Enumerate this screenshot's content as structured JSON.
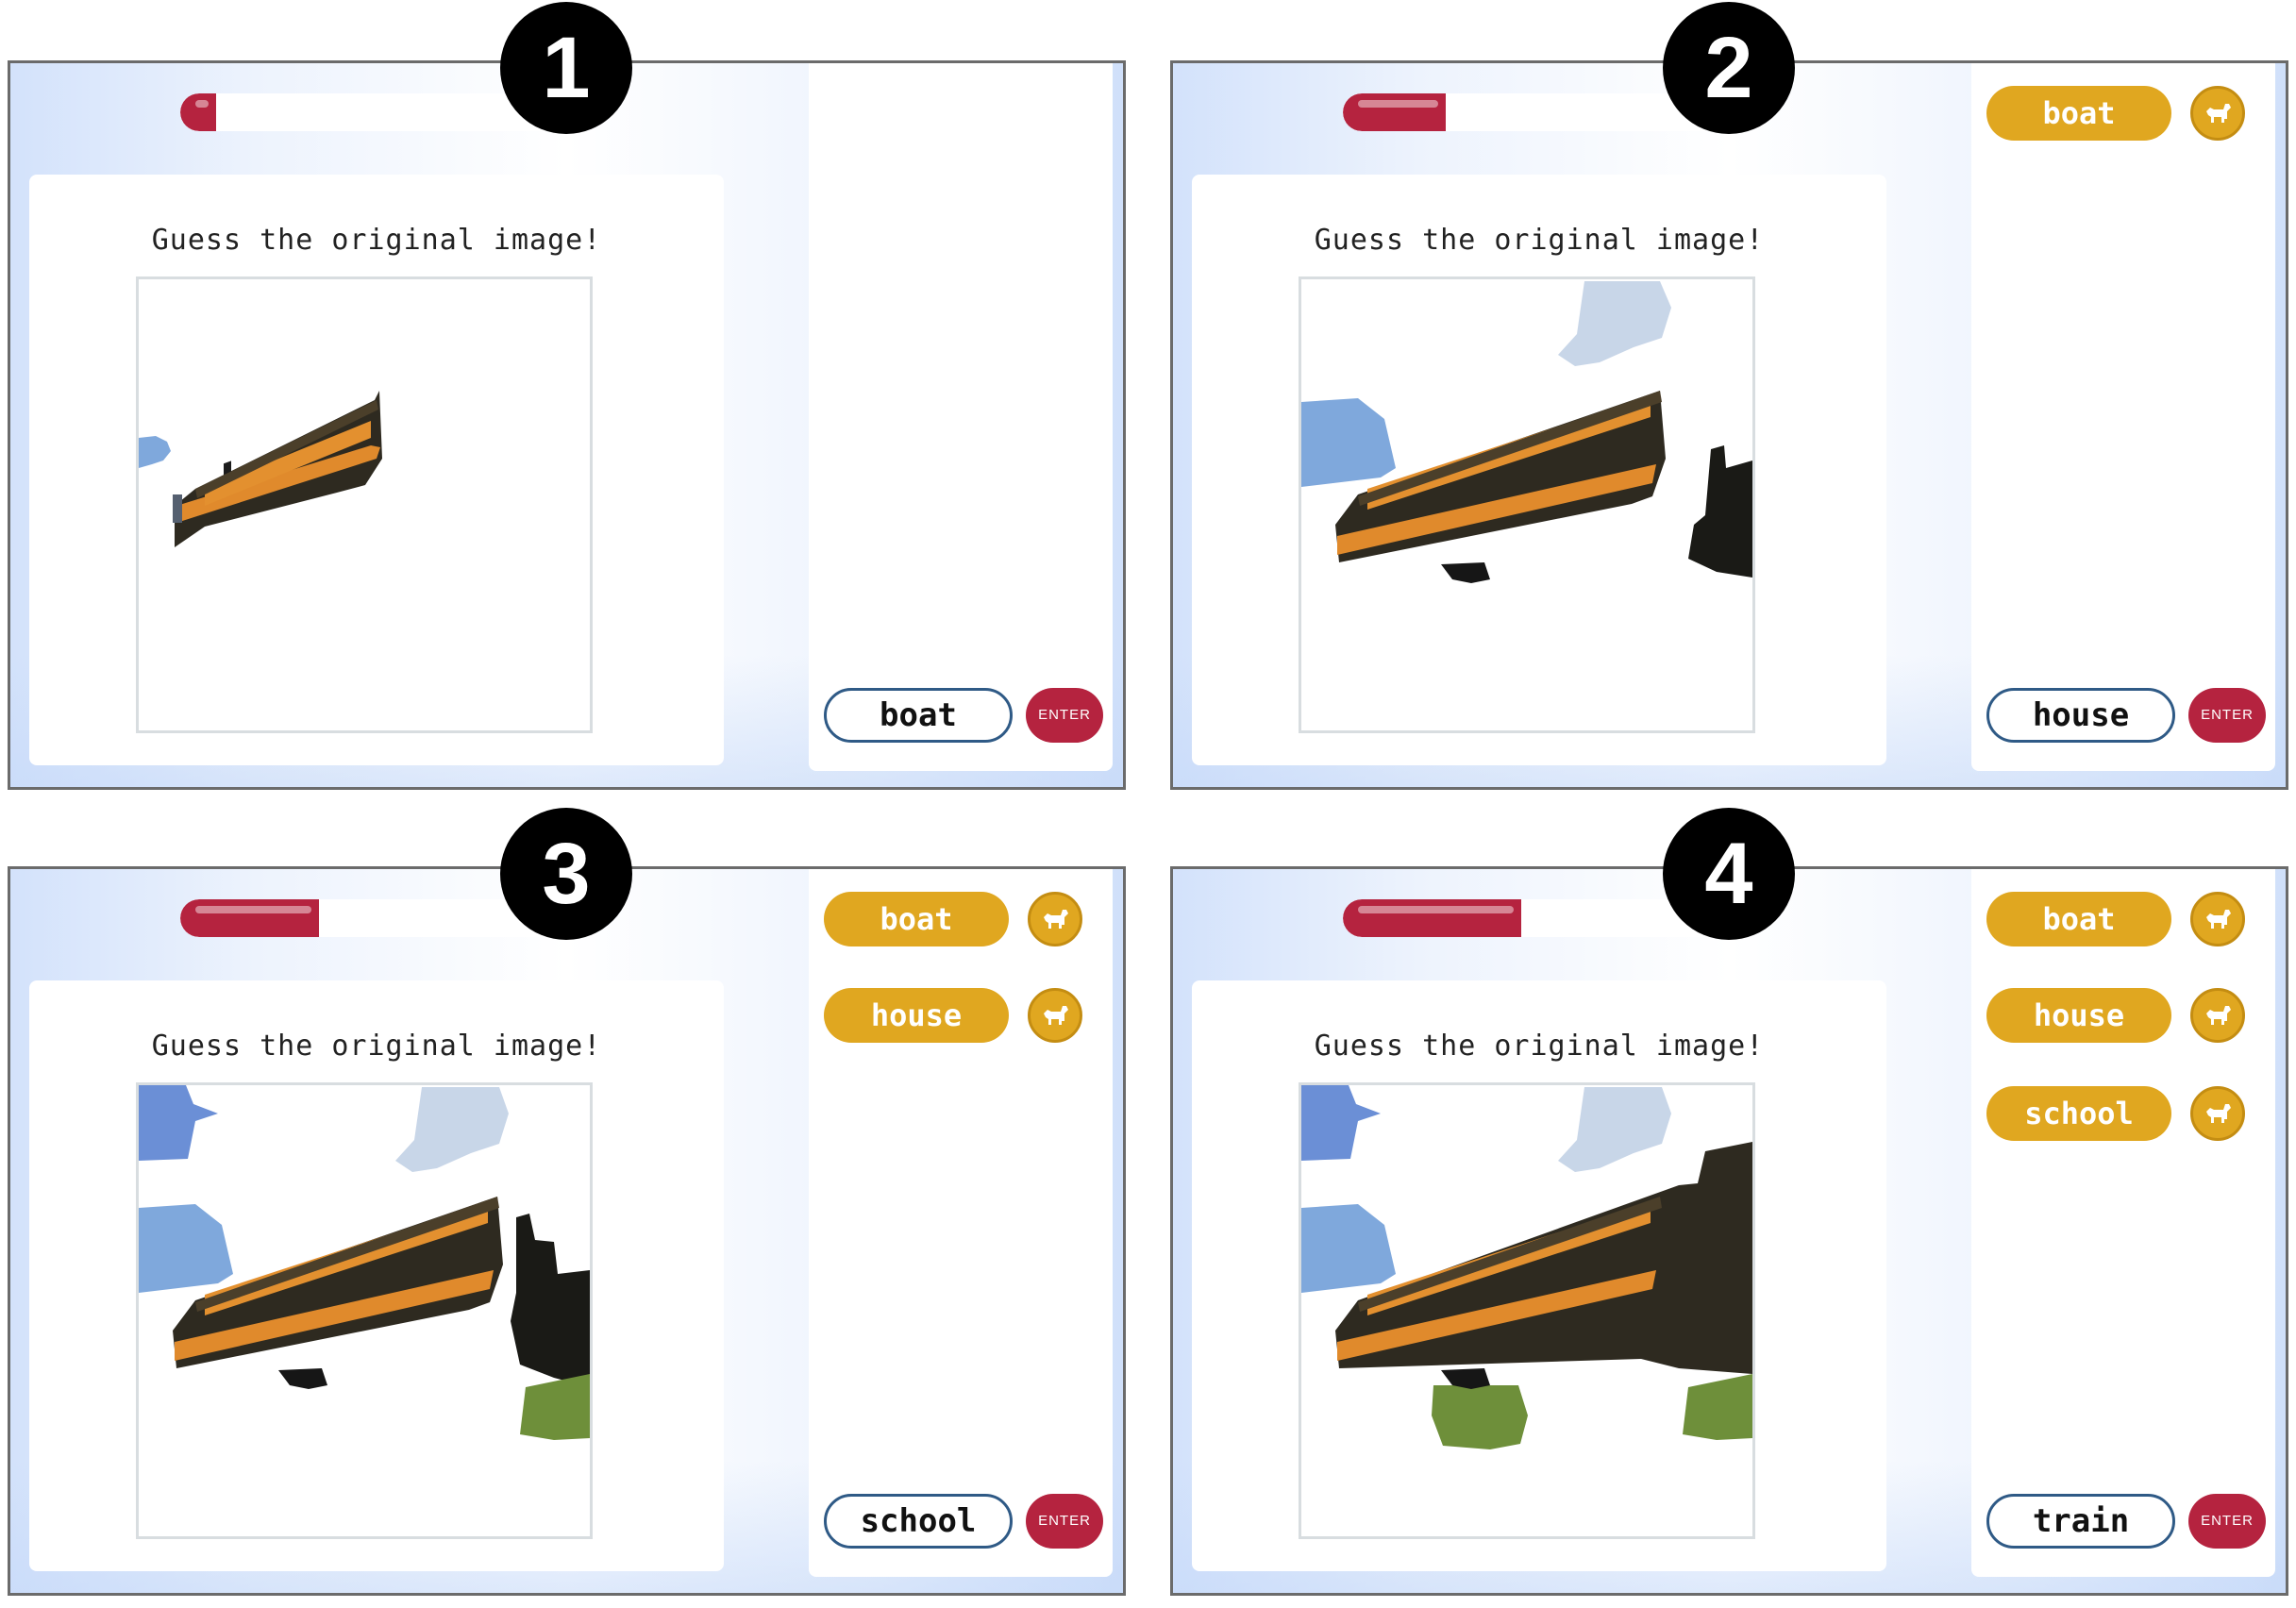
{
  "panels": [
    {
      "step": "1",
      "progress": 0.09,
      "prompt": "Guess the original image!",
      "guesses": [],
      "input_value": "boat",
      "enter_label": "ENTER",
      "colors": {
        "progress": "#b5233f",
        "guess_chip": "#e0a720",
        "input_border": "#2f5a86"
      }
    },
    {
      "step": "2",
      "progress": 0.26,
      "prompt": "Guess the original image!",
      "guesses": [
        "boat"
      ],
      "input_value": "house",
      "enter_label": "ENTER"
    },
    {
      "step": "3",
      "progress": 0.35,
      "prompt": "Guess the original image!",
      "guesses": [
        "boat",
        "house"
      ],
      "input_value": "school",
      "enter_label": "ENTER"
    },
    {
      "step": "4",
      "progress": 0.45,
      "prompt": "Guess the original image!",
      "guesses": [
        "boat",
        "house",
        "school"
      ],
      "input_value": "train",
      "enter_label": "ENTER"
    }
  ],
  "icons": {
    "guess_status": "dog-icon"
  }
}
